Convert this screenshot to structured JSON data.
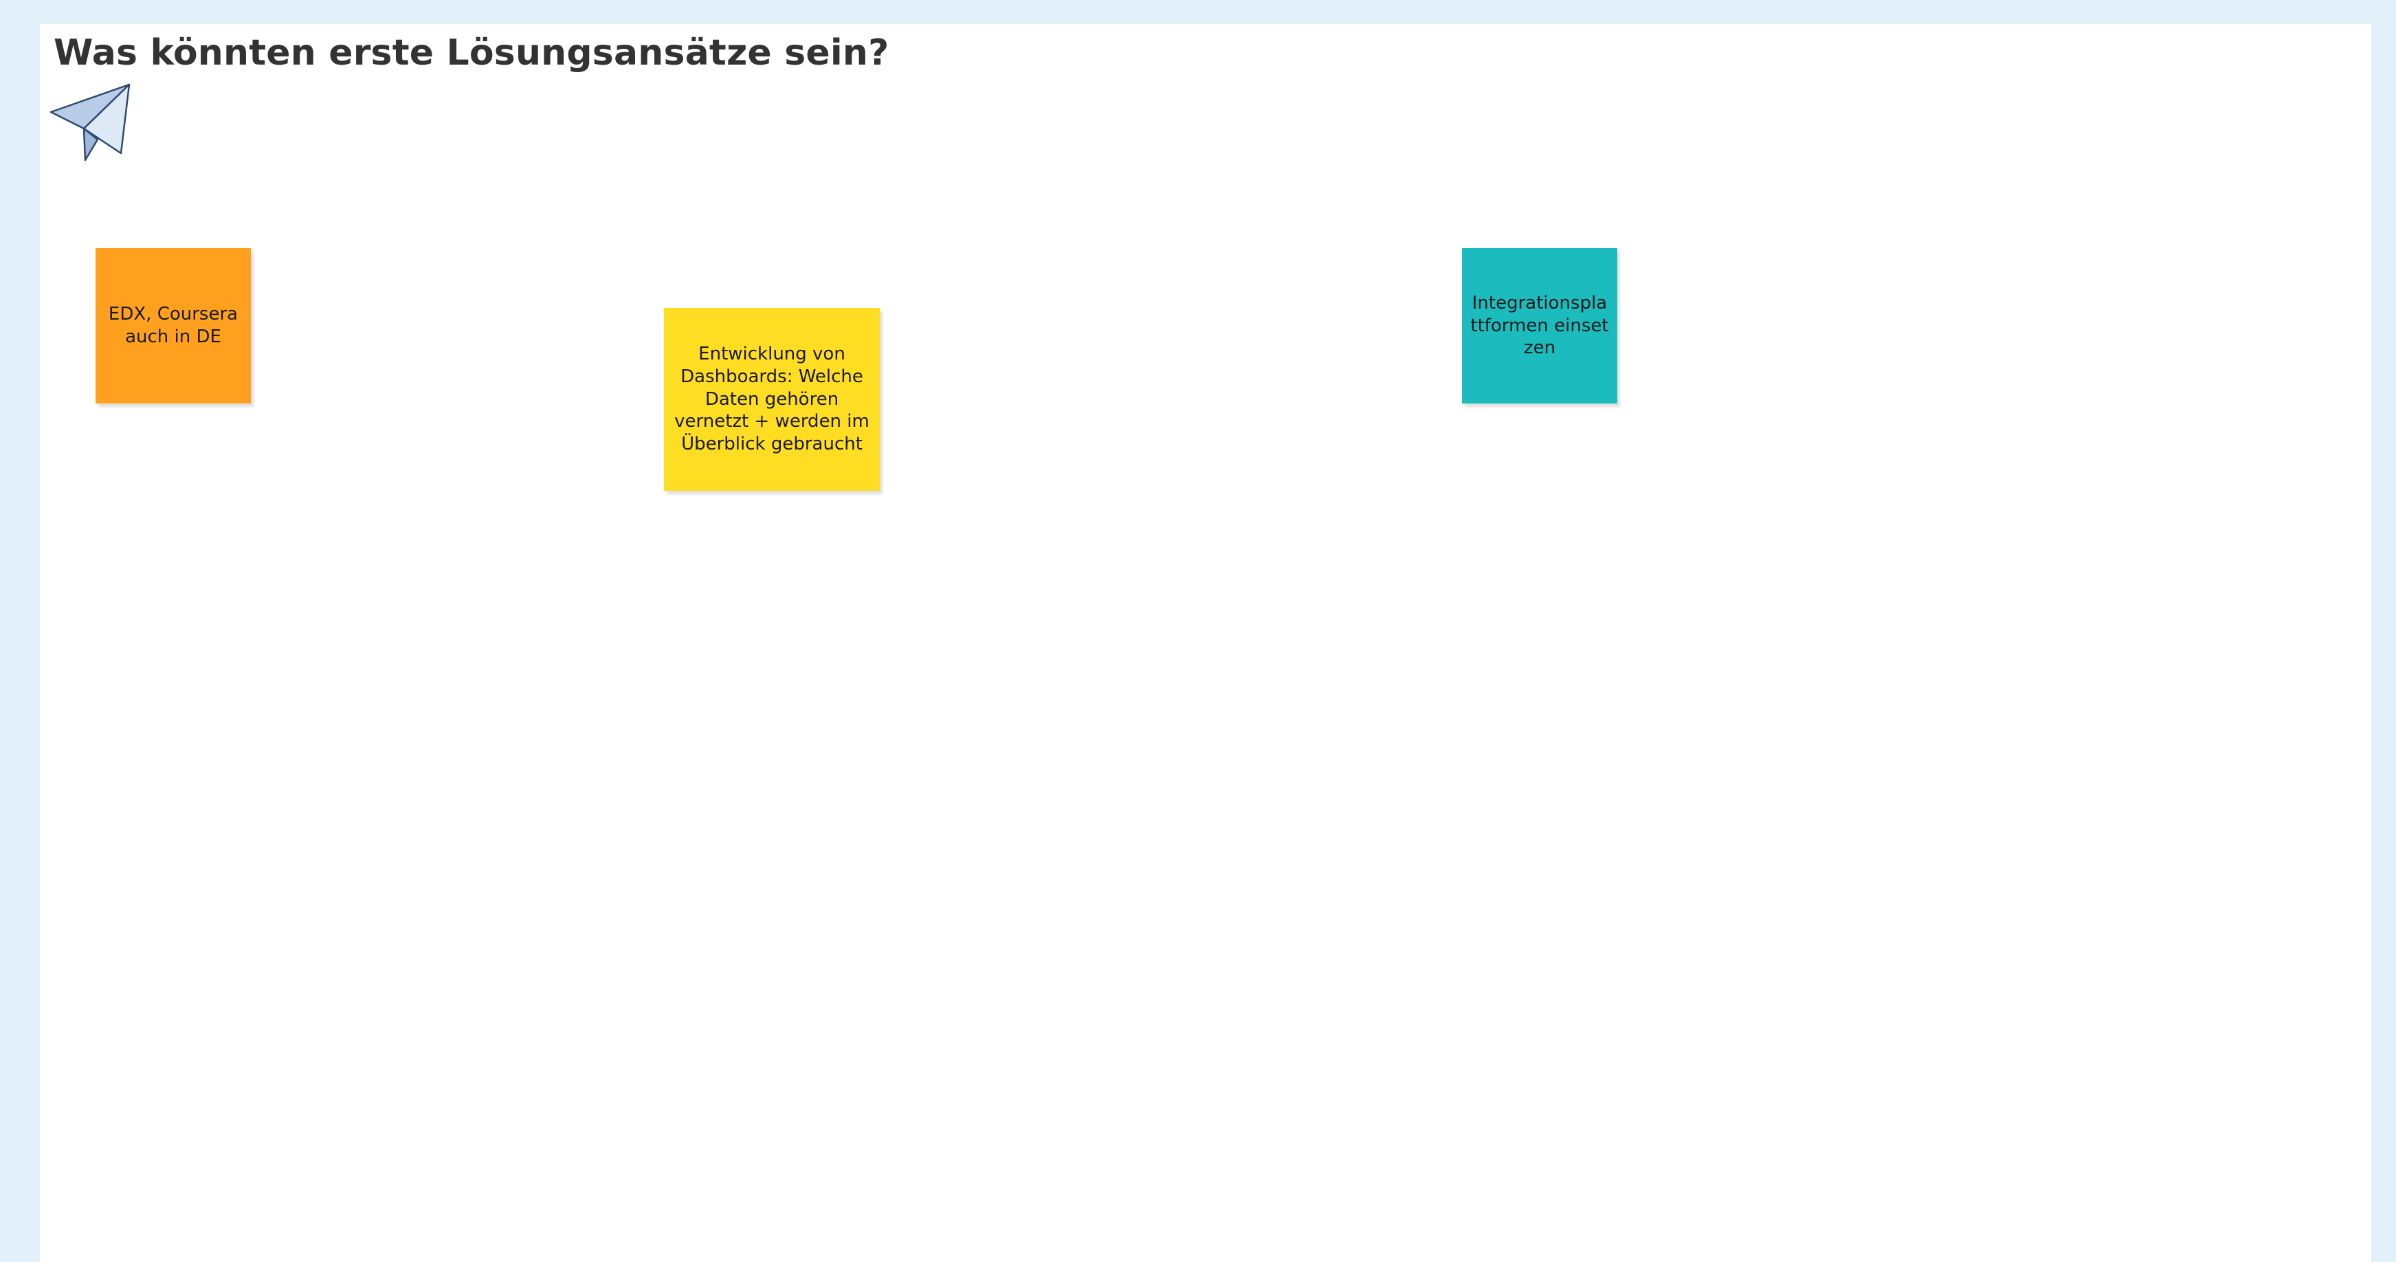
{
  "board": {
    "background_color": "#e2f0f9",
    "frame": {
      "title": "Was könnten erste Lösungsansätze sein?",
      "icon": "paper-plane-icon"
    },
    "notes": [
      {
        "id": "edx",
        "text": "EDX, Coursera auch in DE",
        "color": "#ffa11f"
      },
      {
        "id": "dashboards",
        "text": "Entwicklung von Dashboards: Welche Daten gehören vernetzt + werden im Überblick gebraucht",
        "color": "#fedd22"
      },
      {
        "id": "integration",
        "text": "Integrationsplattformen einsetzen",
        "color": "#1bbbbe"
      }
    ]
  }
}
